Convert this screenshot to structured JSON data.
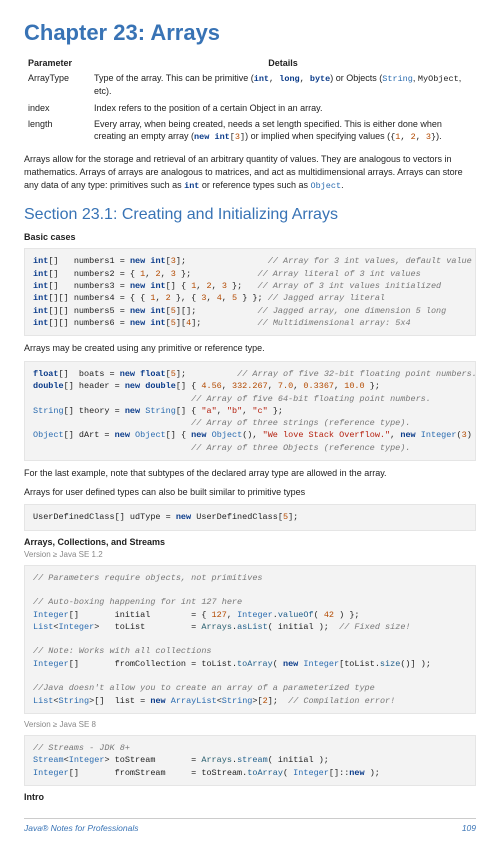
{
  "chapter_title": "Chapter 23: Arrays",
  "params_headers": {
    "p": "Parameter",
    "d": "Details"
  },
  "params": {
    "r1p": "ArrayType",
    "r1d_a": "Type of the array. This can be primitive (",
    "r1d_b": ") or Objects (",
    "r1d_c": ", etc).",
    "r1_kw_int": "int",
    "r1_kw_long": "long",
    "r1_kw_byte": "byte",
    "r1_kw_sep": ", ",
    "r1_str": "String",
    "r1_myo": "MyObject",
    "r2p": "index",
    "r2d": "Index refers to the position of a certain Object in an array.",
    "r3p": "length",
    "r3d_a": "Every array, when being created, needs a set length specified. This is either done when creating an empty array (",
    "r3d_b": ") or implied when specifying values (",
    "r3d_c": ").",
    "r3_new": "new",
    "r3_int": "int",
    "r3_br": "[",
    "r3_n3": "3",
    "r3_br2": "]",
    "r3_ob": "{",
    "r3_n1": "1",
    "r3_cm": ", ",
    "r3_n2": "2",
    "r3_n32": "3",
    "r3_cb": "}"
  },
  "intro_a": "Arrays allow for the storage and retrieval of an arbitrary quantity of values. They are analogous to vectors in mathematics. Arrays of arrays are analogous to matrices, and act as multidimensional arrays. Arrays can store any data of any type: primitives such as ",
  "intro_b": " or reference types such as ",
  "intro_c": ".",
  "intro_int": "int",
  "intro_obj": "Object",
  "section_title": "Section 23.1: Creating and Initializing Arrays",
  "h_basic": "Basic cases",
  "p_prim": "Arrays may be created using any primitive or reference type.",
  "p_last": "For the last example, note that subtypes of the declared array type are allowed in the array.",
  "p_user": "Arrays for user defined types can also be built similar to primitive types",
  "h_coll": "Arrays, Collections, and Streams",
  "ver12": "Version ≥ Java SE 1.2",
  "ver8": "Version ≥ Java SE 8",
  "h_intro": "Intro",
  "footer_l": "Java® Notes for Professionals",
  "footer_r": "109"
}
